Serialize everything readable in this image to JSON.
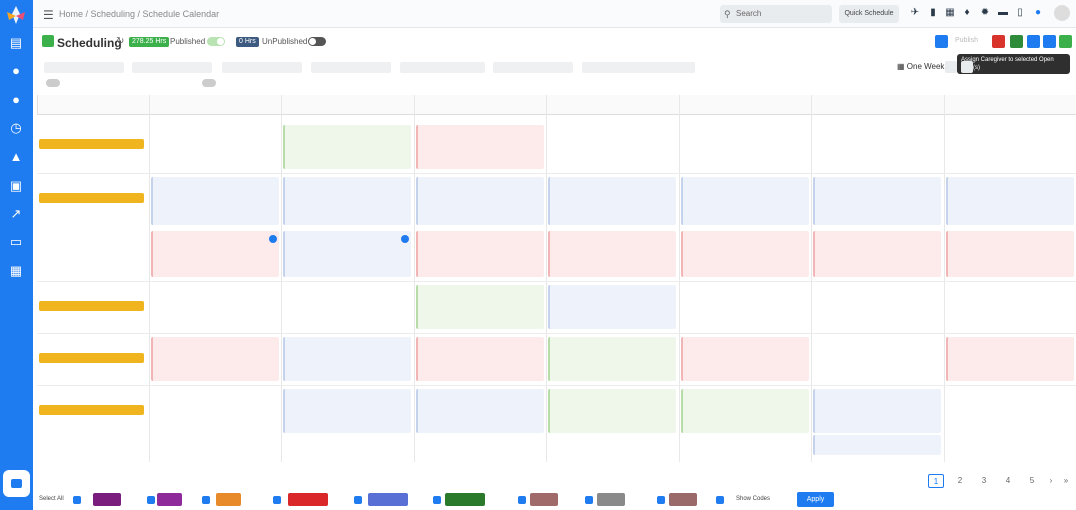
{
  "topbar": {
    "breadcrumb": "Home / Scheduling / Schedule Calendar",
    "search_placeholder": "Search",
    "quick_schedule": "Quick Schedule"
  },
  "header": {
    "title": "Scheduling",
    "published_hours": "278.25 Hrs",
    "published_label": "Published",
    "unpublished_hours": "0 Hrs",
    "unpublished_label": "UnPublished",
    "publish_label": "Publish",
    "tooltip": "Assign Caregiver to selected Open Shift(s)"
  },
  "filters": {
    "week_select": "One Week"
  },
  "colors": {
    "sidebar": "#1e7bf0",
    "published_badge": "#3bb04b",
    "unpublished_badge": "#3d5a80",
    "accent": "#1e7bf0",
    "emp_bar": "#f0b41e"
  },
  "footer": {
    "pages": [
      "1",
      "2",
      "3",
      "4",
      "5"
    ],
    "show_codes": "Show Codes",
    "apply": "Apply",
    "select_all": "Select All"
  }
}
